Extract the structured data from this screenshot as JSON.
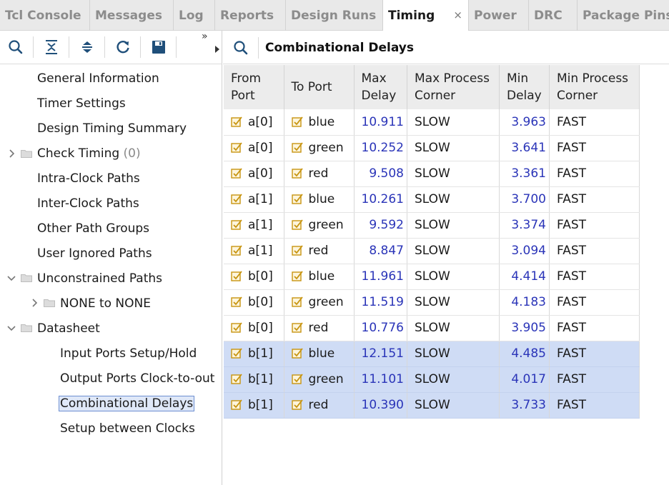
{
  "tabs": [
    {
      "label": "Tcl Console",
      "active": false
    },
    {
      "label": "Messages",
      "active": false
    },
    {
      "label": "Log",
      "active": false
    },
    {
      "label": "Reports",
      "active": false
    },
    {
      "label": "Design Runs",
      "active": false
    },
    {
      "label": "Timing",
      "active": true,
      "close": "×"
    },
    {
      "label": "Power",
      "active": false
    },
    {
      "label": "DRC",
      "active": false
    },
    {
      "label": "Package Pins",
      "active": false
    }
  ],
  "left_toolbar": {
    "buttons": [
      "search-icon",
      "collapse-all-icon",
      "expand-all-icon",
      "refresh-icon",
      "save-icon"
    ],
    "more": "»"
  },
  "tree": [
    {
      "label": "General Information"
    },
    {
      "label": "Timer Settings"
    },
    {
      "label": "Design Timing Summary"
    },
    {
      "label": "Check Timing",
      "count": "(0)",
      "chevron": "right"
    },
    {
      "label": "Intra-Clock Paths"
    },
    {
      "label": "Inter-Clock Paths"
    },
    {
      "label": "Other Path Groups"
    },
    {
      "label": "User Ignored Paths"
    },
    {
      "label": "Unconstrained Paths",
      "chevron": "down"
    },
    {
      "label": "NONE to NONE",
      "chevron": "right"
    },
    {
      "label": "Datasheet",
      "chevron": "down"
    },
    {
      "label": "Input Ports Setup/Hold"
    },
    {
      "label": "Output Ports Clock-to-out"
    },
    {
      "label": "Combinational Delays",
      "selected": true
    },
    {
      "label": "Setup between Clocks"
    }
  ],
  "panel": {
    "title": "Combinational Delays"
  },
  "table": {
    "headers": {
      "from_port": "From\nPort",
      "to_port": "To Port",
      "max_delay": "Max\nDelay",
      "max_corner": "Max Process\nCorner",
      "min_delay": "Min\nDelay",
      "min_corner": "Min Process\nCorner"
    },
    "rows": [
      {
        "from": "a[0]",
        "to": "blue",
        "max": "10.911",
        "maxc": "SLOW",
        "min": "3.963",
        "minc": "FAST",
        "selected": false
      },
      {
        "from": "a[0]",
        "to": "green",
        "max": "10.252",
        "maxc": "SLOW",
        "min": "3.641",
        "minc": "FAST",
        "selected": false
      },
      {
        "from": "a[0]",
        "to": "red",
        "max": "9.508",
        "maxc": "SLOW",
        "min": "3.361",
        "minc": "FAST",
        "selected": false
      },
      {
        "from": "a[1]",
        "to": "blue",
        "max": "10.261",
        "maxc": "SLOW",
        "min": "3.700",
        "minc": "FAST",
        "selected": false
      },
      {
        "from": "a[1]",
        "to": "green",
        "max": "9.592",
        "maxc": "SLOW",
        "min": "3.374",
        "minc": "FAST",
        "selected": false
      },
      {
        "from": "a[1]",
        "to": "red",
        "max": "8.847",
        "maxc": "SLOW",
        "min": "3.094",
        "minc": "FAST",
        "selected": false
      },
      {
        "from": "b[0]",
        "to": "blue",
        "max": "11.961",
        "maxc": "SLOW",
        "min": "4.414",
        "minc": "FAST",
        "selected": false
      },
      {
        "from": "b[0]",
        "to": "green",
        "max": "11.519",
        "maxc": "SLOW",
        "min": "4.183",
        "minc": "FAST",
        "selected": false
      },
      {
        "from": "b[0]",
        "to": "red",
        "max": "10.776",
        "maxc": "SLOW",
        "min": "3.905",
        "minc": "FAST",
        "selected": false
      },
      {
        "from": "b[1]",
        "to": "blue",
        "max": "12.151",
        "maxc": "SLOW",
        "min": "4.485",
        "minc": "FAST",
        "selected": true
      },
      {
        "from": "b[1]",
        "to": "green",
        "max": "11.101",
        "maxc": "SLOW",
        "min": "4.017",
        "minc": "FAST",
        "selected": true
      },
      {
        "from": "b[1]",
        "to": "red",
        "max": "10.390",
        "maxc": "SLOW",
        "min": "3.733",
        "minc": "FAST",
        "selected": true
      }
    ]
  },
  "colors": {
    "accent_blue": "#2a34b8",
    "selection": "#cfdcf5",
    "port_icon": "#c79410"
  }
}
